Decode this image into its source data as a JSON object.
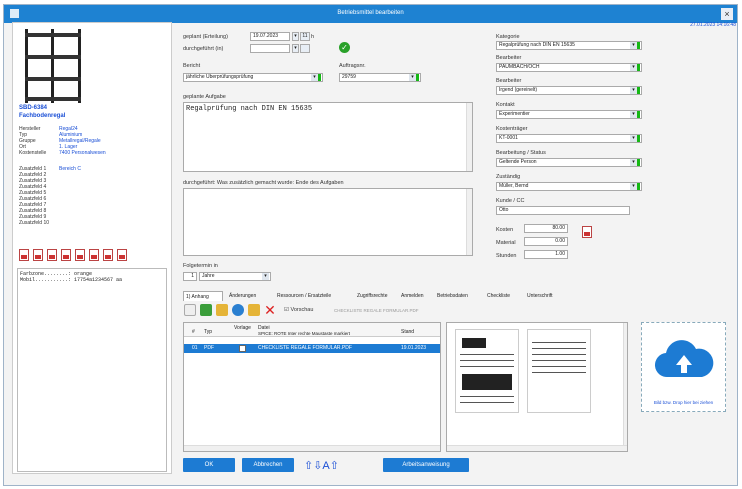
{
  "window": {
    "title": "Betriebsmittel bearbeiten",
    "close": "×",
    "timestamp": "27.01.2023 14:16:48"
  },
  "item": {
    "number": "SBD-6384",
    "name": "Fachbodenregal",
    "fields": [
      {
        "k": "Hersteller",
        "v": "Regal24"
      },
      {
        "k": "Typ",
        "v": "Aluminium"
      },
      {
        "k": "Gruppe",
        "v": "Metallregal/Regale"
      },
      {
        "k": "Ort",
        "v": "1. Lager"
      },
      {
        "k": "Kostenstelle",
        "v": "7400 Personalwesen"
      },
      {
        "k": "Zusatzfeld 1",
        "v": "Bereich C"
      }
    ],
    "extra_fields": [
      "Zusatzfeld 2",
      "Zusatzfeld 3",
      "Zusatzfeld 4",
      "Zusatzfeld 5",
      "Zusatzfeld 6",
      "Zusatzfeld 7",
      "Zusatzfeld 8",
      "Zusatzfeld 9",
      "Zusatzfeld 10"
    ],
    "notes": [
      "Farbzone........: orange",
      "Mobil...........: 17754a1234567 aa"
    ]
  },
  "form": {
    "geplant_label": "geplant (Erteilung)",
    "geplant_date": "19.07.2023",
    "geplant_time": "11",
    "durchgefuehrt_label": "durchgeführt (in)",
    "durchgefuehrt_date": "",
    "durchgefuehrt_time": "",
    "vorbehalt_label": "Bericht",
    "vorbehalt_value": "jährliche Überprüfungsprüfung",
    "auftrag_label": "Auftragsnr.",
    "auftrag_value": "29759",
    "aufgabe_label": "geplante Aufgabe",
    "aufgabe_value": "Regalprüfung nach DIN EN 15635",
    "ergebnis_label": "durchgeführt: Was zusätzlich gemacht wurde: Ende des Aufgaben",
    "ergebnis_value": "",
    "intervall_label": "Folgetermin in",
    "intervall_num": "1",
    "intervall_unit": "Jahre"
  },
  "right": {
    "kategorie_label": "Kategorie",
    "kategorie_value": "Regalprüfung nach DIN EN 15635",
    "bearbeiter_label": "Bearbeiter",
    "bearbeiter_value": "PAUMBACH/OCH",
    "prioritaet_label": "Bearbeiter",
    "prioritaet_value": "Irgend (gereinelt)",
    "kontakt_label": "Kontakt",
    "kontakt_value": "Experimentier",
    "kostentraeger_label": "Kostenträger",
    "kostentraeger_value": "KT-0001",
    "bearbeitung_label": "Bearbeitung / Status",
    "bearbeitung_value": "Geltende Person",
    "zustaendig_label": "Zuständig",
    "zustaendig_value": "Müller, Bernd",
    "kunde_label": "Kunde / CC",
    "kunde_value": "Otto",
    "kosten_label": "Kosten",
    "kosten_value": "80.00",
    "material_label": "Material",
    "material_value": "0.00",
    "stunden_label": "Stunden",
    "stunden_value": "1.00"
  },
  "tabs": [
    "1) Anhang",
    "Änderungen",
    "Ressourcen / Ersatzteile",
    "Zugriffsrechte",
    "Anmelden",
    "Betriebsdaten",
    "Checkliste",
    "Unterschrift"
  ],
  "toolbar": {
    "vorschau_label": "Vorschau",
    "path_hint": "CHECKLISTE REGALE FORMULAR.PDF"
  },
  "grid": {
    "headers": [
      "#",
      "Typ",
      "Vorlage",
      "Datei",
      "Stand"
    ],
    "subheader": "SPICE: ROTE Inter rechte Maustaste markiert",
    "row": {
      "num": "01",
      "typ": "PDF",
      "datei": "CHECKLISTE REGALE FORMULAR.PDF",
      "stand": "19.01.2023"
    }
  },
  "drop": {
    "text": "Bild bzw. Drop hier bei ziehen"
  },
  "buttons": {
    "ok": "OK",
    "abbrechen": "Abbrechen",
    "arbeitsanweisung": "Arbeitsanweisung",
    "up_icons": "⇧⇩A⇧"
  },
  "colors": {
    "accent": "#1d7bd3",
    "link": "#1a4fd6",
    "ok_green": "#2aa12a"
  }
}
